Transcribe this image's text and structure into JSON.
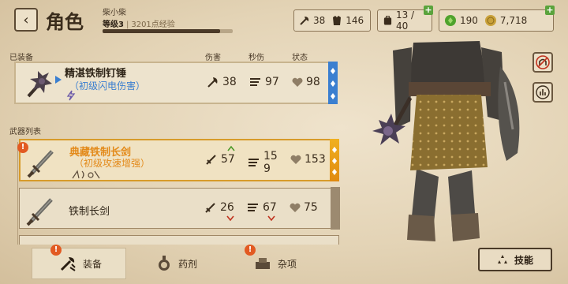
{
  "header": {
    "back_icon": "back-arrow-icon",
    "title": "角色",
    "player_name": "柴小柴",
    "level": "等级3",
    "xp": "3201点经验",
    "xp_progress": 0.9
  },
  "resources": {
    "attack": "38",
    "defense": "146",
    "inventory": "13 / 40",
    "gems": "190",
    "gold": "7,718"
  },
  "equipped": {
    "section_label": "已装备",
    "col_damage": "伤害",
    "col_dps": "秒伤",
    "col_status": "状态",
    "item": {
      "name": "精湛铁制钉锤",
      "effect": "（初级闪电伤害）",
      "damage": "38",
      "dps": "97",
      "status": "98"
    }
  },
  "weapons": {
    "section_label": "武器列表",
    "items": [
      {
        "name": "典藏铁制长剑",
        "effect": "（初级攻速增强）",
        "damage": "57",
        "dps_top": "15",
        "dps_bottom": "9",
        "status": "153"
      },
      {
        "name": "铁制长剑",
        "effect": "",
        "damage": "26",
        "dps": "67",
        "status": "75"
      }
    ]
  },
  "tabs": [
    {
      "label": "装备",
      "icon": "equipment-icon"
    },
    {
      "label": "药剂",
      "icon": "potion-icon"
    },
    {
      "label": "杂项",
      "icon": "misc-icon"
    }
  ],
  "skills_button": "技能",
  "colors": {
    "accent_gold": "#e38a1a",
    "lightning_blue": "#3b7fd0",
    "warning": "#e25a22",
    "gem_green": "#4fa32d"
  }
}
